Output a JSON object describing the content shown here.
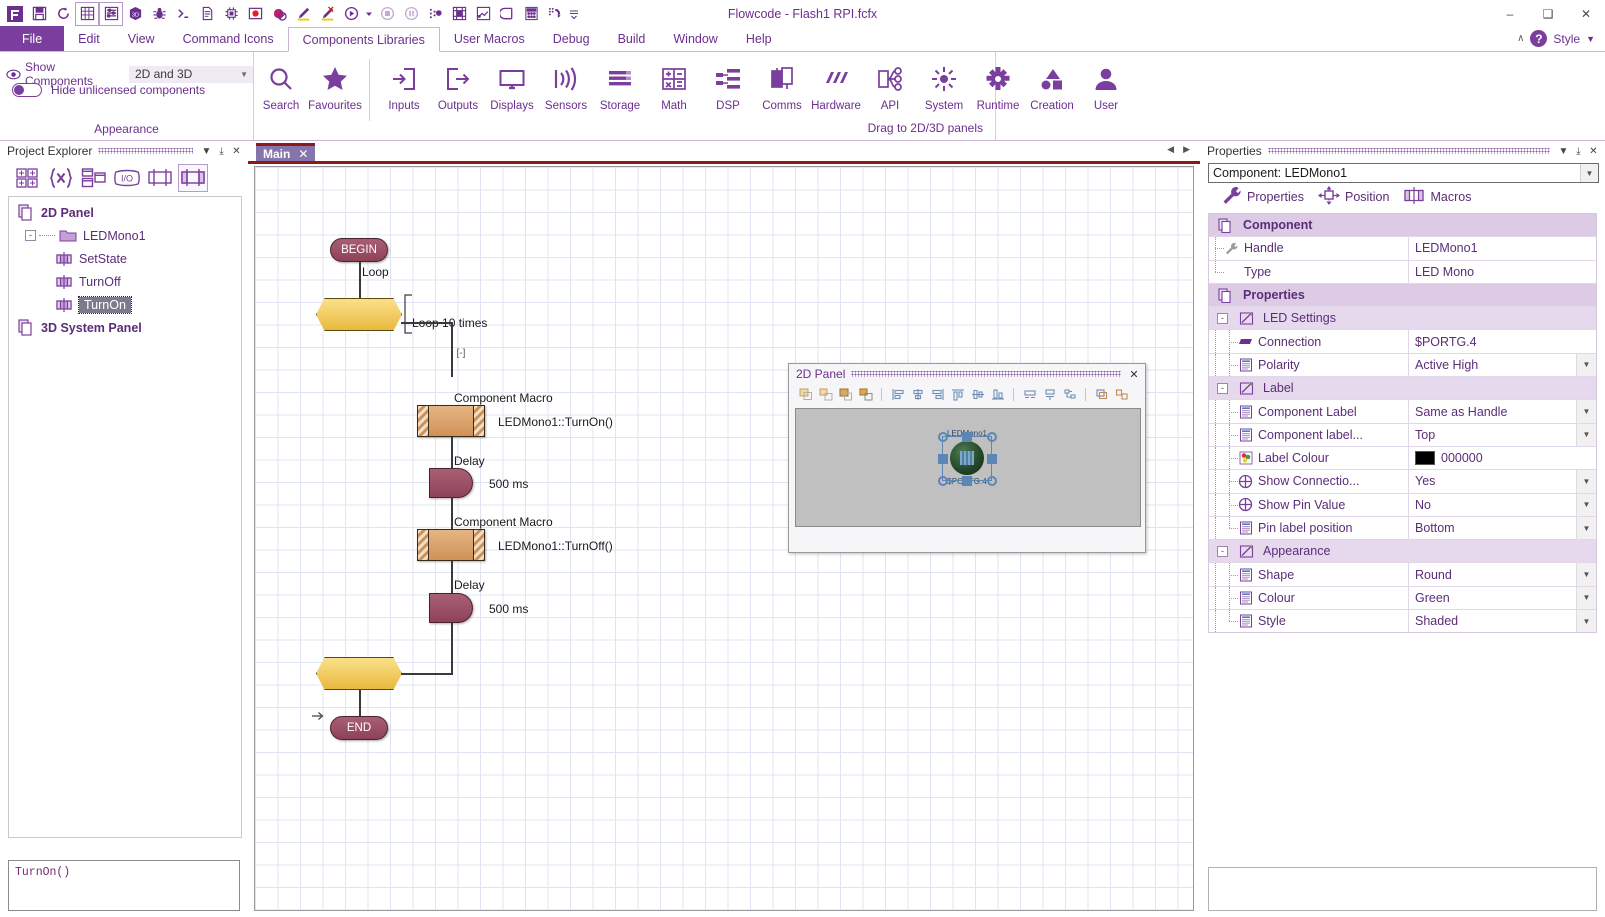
{
  "window": {
    "title": "Flowcode - Flash1 RPI.fcfx",
    "minimize": "–",
    "maximize": "❑",
    "close": "✕"
  },
  "quick_access": [
    {
      "name": "flowcode-logo-icon",
      "tip": "Flowcode"
    },
    {
      "name": "save-icon",
      "tip": "Save"
    },
    {
      "name": "refresh-icon",
      "tip": "Refresh"
    },
    {
      "name": "grid-panel-icon",
      "tip": "2D Panel"
    },
    {
      "name": "properties-list-icon",
      "tip": "Properties"
    },
    {
      "name": "cube-3d-icon",
      "tip": "3D Panel"
    },
    {
      "name": "bug-icon",
      "tip": "Debug"
    },
    {
      "name": "console-icon",
      "tip": "Console"
    },
    {
      "name": "document-icon",
      "tip": "Document"
    },
    {
      "name": "chip-icon",
      "tip": "Chip"
    },
    {
      "name": "record-icon",
      "tip": "Record"
    },
    {
      "name": "record-stop-icon",
      "tip": "Stop record"
    },
    {
      "name": "pencil-icon",
      "tip": "Edit"
    },
    {
      "name": "pencil-disabled-icon",
      "tip": "Edit off"
    },
    {
      "name": "play-icon",
      "tip": "Run"
    },
    {
      "name": "play-dropdown-icon",
      "tip": "Run options"
    },
    {
      "name": "stop-icon",
      "tip": "Stop"
    },
    {
      "name": "pause-icon",
      "tip": "Pause"
    },
    {
      "name": "step-icon",
      "tip": "Step"
    },
    {
      "name": "simulation-icon",
      "tip": "Simulation"
    },
    {
      "name": "chart-icon",
      "tip": "Data"
    },
    {
      "name": "compile-icon",
      "tip": "Compile"
    },
    {
      "name": "calculator-icon",
      "tip": "Calculator"
    },
    {
      "name": "export-icon",
      "tip": "Export"
    },
    {
      "name": "overflow-icon",
      "tip": "More"
    }
  ],
  "menu": {
    "items": [
      {
        "label": "File",
        "id": "file"
      },
      {
        "label": "Edit",
        "id": "edit"
      },
      {
        "label": "View",
        "id": "view"
      },
      {
        "label": "Command Icons",
        "id": "command-icons"
      },
      {
        "label": "Components Libraries",
        "id": "components-libraries"
      },
      {
        "label": "User Macros",
        "id": "user-macros"
      },
      {
        "label": "Debug",
        "id": "debug"
      },
      {
        "label": "Build",
        "id": "build"
      },
      {
        "label": "Window",
        "id": "window"
      },
      {
        "label": "Help",
        "id": "help"
      }
    ],
    "active": "Components Libraries",
    "right": {
      "collapse": "∧",
      "help": "?",
      "style_label": "Style",
      "style_caret": "▼"
    }
  },
  "ribbon": {
    "appearance": {
      "show_components_label": "Show Components",
      "show_components_value": "2D and 3D",
      "hide_unlicensed_label": "Hide unlicensed components",
      "hide_unlicensed_on": false,
      "caption": "Appearance"
    },
    "libraries": {
      "caption": "Drag to 2D/3D panels",
      "buttons": [
        {
          "label": "Search",
          "icon": "search-icon"
        },
        {
          "label": "Favourites",
          "icon": "star-icon"
        },
        {
          "label": "Inputs",
          "icon": "inputs-icon"
        },
        {
          "label": "Outputs",
          "icon": "outputs-icon"
        },
        {
          "label": "Displays",
          "icon": "monitor-icon"
        },
        {
          "label": "Sensors",
          "icon": "sensors-icon"
        },
        {
          "label": "Storage",
          "icon": "storage-icon"
        },
        {
          "label": "Math",
          "icon": "math-icon"
        },
        {
          "label": "DSP",
          "icon": "dsp-icon"
        },
        {
          "label": "Comms",
          "icon": "comms-icon"
        },
        {
          "label": "Hardware",
          "icon": "hardware-icon"
        },
        {
          "label": "API",
          "icon": "api-icon"
        },
        {
          "label": "System",
          "icon": "system-icon"
        },
        {
          "label": "Runtime",
          "icon": "gear-icon"
        },
        {
          "label": "Creation",
          "icon": "shapes-icon"
        },
        {
          "label": "User",
          "icon": "user-icon"
        }
      ]
    }
  },
  "project_explorer": {
    "title": "Project Explorer",
    "header_buttons": {
      "dropdown": "▼",
      "pin": "⤓",
      "close": "✕"
    },
    "toolbar": [
      {
        "name": "panels-icon",
        "selected": false
      },
      {
        "name": "variables-icon",
        "selected": false
      },
      {
        "name": "windows-icon",
        "selected": false
      },
      {
        "name": "io-icon",
        "selected": false
      },
      {
        "name": "component-icon",
        "selected": false
      },
      {
        "name": "macros-icon",
        "selected": true
      }
    ],
    "tree": [
      {
        "label": "2D Panel",
        "level": 0,
        "icon": "panel-stack-icon",
        "bold": true,
        "selected": false,
        "expander": ""
      },
      {
        "label": "LEDMono1",
        "level": 1,
        "icon": "folder-icon",
        "bold": false,
        "selected": false,
        "expander": "-"
      },
      {
        "label": "SetState",
        "level": 2,
        "icon": "macro-icon",
        "bold": false,
        "selected": false,
        "expander": ""
      },
      {
        "label": "TurnOff",
        "level": 2,
        "icon": "macro-icon",
        "bold": false,
        "selected": false,
        "expander": ""
      },
      {
        "label": "TurnOn",
        "level": 2,
        "icon": "macro-icon",
        "bold": false,
        "selected": true,
        "expander": ""
      },
      {
        "label": "3D System Panel",
        "level": 0,
        "icon": "panel-stack-icon",
        "bold": true,
        "selected": false,
        "expander": ""
      }
    ],
    "code_preview": "TurnOn()"
  },
  "editor": {
    "tab": {
      "label": "Main",
      "close": "✕"
    },
    "nav_prev": "◀",
    "nav_next": "▶",
    "flowchart": {
      "begin_label": "BEGIN",
      "end_label": "END",
      "loop_title": "Loop",
      "loop_condition": "Loop 10 times",
      "collapse_marker": "[-]",
      "nodes": [
        {
          "type": "macro",
          "title": "Component Macro",
          "value": "LEDMono1::TurnOn()"
        },
        {
          "type": "delay",
          "title": "Delay",
          "value": "500 ms"
        },
        {
          "type": "macro",
          "title": "Component Macro",
          "value": "LEDMono1::TurnOff()"
        },
        {
          "type": "delay",
          "title": "Delay",
          "value": "500 ms"
        }
      ]
    }
  },
  "panel2d": {
    "title": "2D Panel",
    "close": "✕",
    "toolbar": [
      {
        "name": "bring-to-front-icon"
      },
      {
        "name": "bring-forward-icon"
      },
      {
        "name": "send-backward-icon"
      },
      {
        "name": "send-to-back-icon"
      },
      {
        "name": "align-left-icon"
      },
      {
        "name": "align-center-icon"
      },
      {
        "name": "align-right-icon"
      },
      {
        "name": "align-top-icon"
      },
      {
        "name": "align-middle-icon"
      },
      {
        "name": "align-bottom-icon"
      },
      {
        "name": "distribute-horizontal-icon"
      },
      {
        "name": "distribute-vertical-icon"
      },
      {
        "name": "group-icon"
      },
      {
        "name": "ungroup-icon"
      },
      {
        "name": "snap-icon"
      }
    ],
    "component": {
      "top_label": "LEDMono1",
      "bottom_label": "$PORTG.4"
    }
  },
  "properties": {
    "title": "Properties",
    "header_buttons": {
      "dropdown": "▼",
      "pin": "⤓",
      "close": "✕"
    },
    "selector_value": "Component: LEDMono1",
    "tabs": [
      {
        "label": "Properties",
        "icon": "wrench-icon",
        "active": true
      },
      {
        "label": "Position",
        "icon": "move-icon",
        "active": false
      },
      {
        "label": "Macros",
        "icon": "macros-icon",
        "active": false
      }
    ],
    "rows": [
      {
        "kind": "group",
        "name": "Component",
        "icon": "panel-stack-icon",
        "value": "",
        "dropdown": false,
        "indent": 0
      },
      {
        "kind": "item",
        "name": "Handle",
        "icon": "wrench-small-icon",
        "value": "LEDMono1",
        "dropdown": false,
        "indent": 1
      },
      {
        "kind": "item",
        "name": "Type",
        "icon": "",
        "value": "LED Mono",
        "dropdown": false,
        "indent": 1
      },
      {
        "kind": "group",
        "name": "Properties",
        "icon": "panel-stack-icon",
        "value": "",
        "dropdown": false,
        "indent": 0
      },
      {
        "kind": "subgroup",
        "name": "LED Settings",
        "icon": "folder-edit-icon",
        "value": "",
        "dropdown": false,
        "indent": 1,
        "expander": "-"
      },
      {
        "kind": "item",
        "name": "Connection",
        "icon": "connection-icon",
        "value": "$PORTG.4",
        "dropdown": false,
        "indent": 2
      },
      {
        "kind": "item",
        "name": "Polarity",
        "icon": "list-icon",
        "value": "Active High",
        "dropdown": true,
        "indent": 2
      },
      {
        "kind": "subgroup",
        "name": "Label",
        "icon": "folder-edit-icon",
        "value": "",
        "dropdown": false,
        "indent": 1,
        "expander": "-"
      },
      {
        "kind": "item",
        "name": "Component Label",
        "icon": "list-icon",
        "value": "Same as Handle",
        "dropdown": true,
        "indent": 2
      },
      {
        "kind": "item",
        "name": "Component label...",
        "icon": "list-icon",
        "value": "Top",
        "dropdown": true,
        "indent": 2
      },
      {
        "kind": "item",
        "name": "Label Colour",
        "icon": "palette-icon",
        "value": "000000",
        "dropdown": false,
        "indent": 2,
        "swatch": "#000000"
      },
      {
        "kind": "item",
        "name": "Show Connectio...",
        "icon": "crosshair-icon",
        "value": "Yes",
        "dropdown": true,
        "indent": 2
      },
      {
        "kind": "item",
        "name": "Show Pin Value",
        "icon": "crosshair-icon",
        "value": "No",
        "dropdown": true,
        "indent": 2
      },
      {
        "kind": "item",
        "name": "Pin label position",
        "icon": "list-icon",
        "value": "Bottom",
        "dropdown": true,
        "indent": 2
      },
      {
        "kind": "subgroup",
        "name": "Appearance",
        "icon": "folder-edit-icon",
        "value": "",
        "dropdown": false,
        "indent": 1,
        "expander": "-"
      },
      {
        "kind": "item",
        "name": "Shape",
        "icon": "list-icon",
        "value": "Round",
        "dropdown": true,
        "indent": 2
      },
      {
        "kind": "item",
        "name": "Colour",
        "icon": "list-icon",
        "value": "Green",
        "dropdown": true,
        "indent": 2
      },
      {
        "kind": "item",
        "name": "Style",
        "icon": "list-icon",
        "value": "Shaded",
        "dropdown": true,
        "indent": 2
      }
    ]
  },
  "colors": {
    "accent": "#6b2f8e",
    "file_tab": "#7a3f9d",
    "tab_red": "#8b1a1a",
    "group_row": "#ddcbe6",
    "loop_yellow": "#e8b93f",
    "macro_orange": "#cf9258",
    "delay_maroon": "#8e4258"
  }
}
